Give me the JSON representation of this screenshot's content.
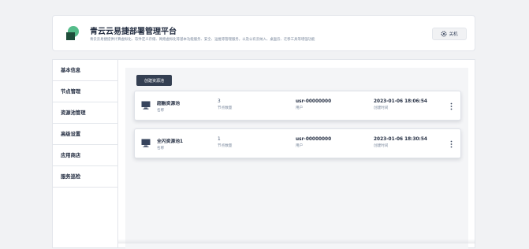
{
  "header": {
    "title": "青云云易捷部署管理平台",
    "subtitle": "青云云易捷提供计算虚拟化、软件定义存储、网络虚拟化等基本功能服务、安全、运维等管理服务，以及公有云纳入、桌面云、迁移工具等增强功能",
    "shutdown_label": "关机"
  },
  "sidebar": {
    "items": [
      {
        "label": "基本信息"
      },
      {
        "label": "节点管理"
      },
      {
        "label": "资源池管理"
      },
      {
        "label": "高级设置"
      },
      {
        "label": "应用商店"
      },
      {
        "label": "服务巡检"
      }
    ]
  },
  "main": {
    "create_button": "创建资源池",
    "pools": [
      {
        "name": "超融资源池",
        "name_key": "名称",
        "node_count": "3",
        "node_count_key": "节点数量",
        "user": "usr-00000000",
        "user_key": "用户",
        "created": "2023-01-06 18:06:54",
        "created_key": "创建时间"
      },
      {
        "name": "全闪资源池1",
        "name_key": "名称",
        "node_count": "1",
        "node_count_key": "节点数量",
        "user": "usr-00000000",
        "user_key": "用户",
        "created": "2023-01-06 18:30:54",
        "created_key": "创建时间"
      }
    ]
  },
  "colors": {
    "logo_green": "#55bc8a",
    "logo_dark": "#1f4d3a",
    "primary_dark": "#343f52"
  }
}
